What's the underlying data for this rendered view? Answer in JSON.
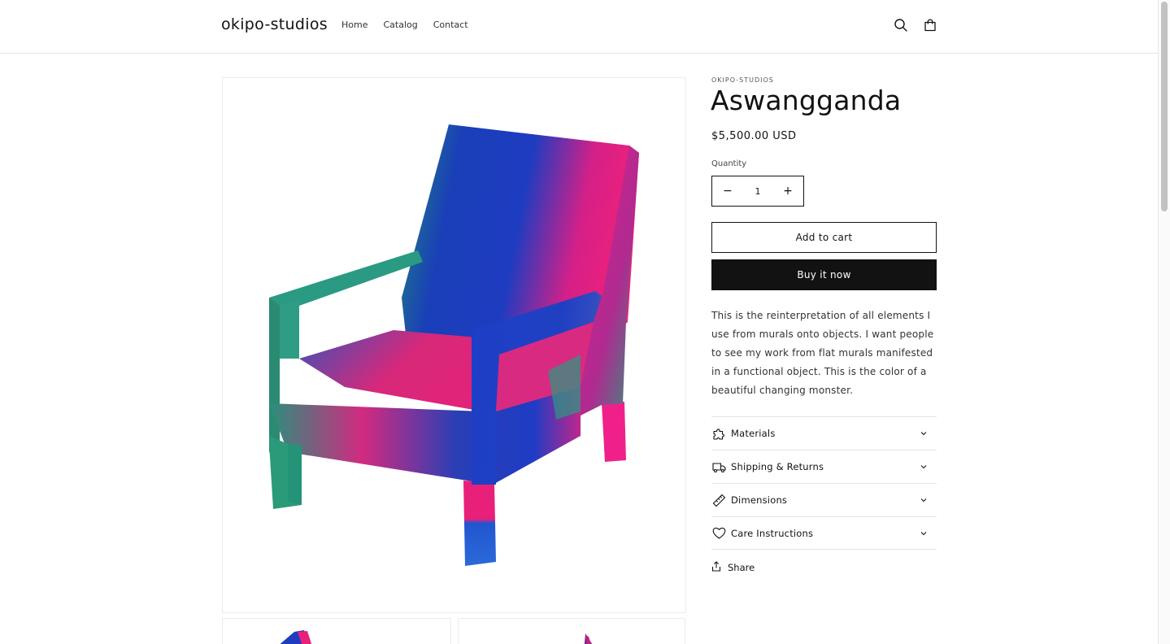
{
  "header": {
    "logo": "okipo-studios",
    "nav": [
      {
        "label": "Home"
      },
      {
        "label": "Catalog"
      },
      {
        "label": "Contact"
      }
    ],
    "icons": [
      "search-icon",
      "cart-icon"
    ]
  },
  "product": {
    "vendor": "OKIPO-STUDIOS",
    "title": "Aswangganda",
    "price": "$5,500.00 USD",
    "quantity_label": "Quantity",
    "quantity_value": "1",
    "decrease_symbol": "−",
    "increase_symbol": "+",
    "add_to_cart": "Add to cart",
    "buy_now": "Buy it now",
    "description": "This is the reinterpretation of all elements I use from murals onto objects. I want people to see my work from flat murals manifested in a functional object. This is the color of a beautiful changing monster.",
    "accordions": [
      {
        "label": "Materials",
        "icon": "puzzle-icon"
      },
      {
        "label": "Shipping & Returns",
        "icon": "truck-icon"
      },
      {
        "label": "Dimensions",
        "icon": "ruler-icon"
      },
      {
        "label": "Care Instructions",
        "icon": "heart-icon"
      }
    ],
    "share_label": "Share"
  },
  "colors": {
    "text": "#121212",
    "button_dark": "#121212",
    "chair_blue": "#1a3fb8",
    "chair_pink": "#e8207a",
    "chair_teal": "#2a9a7e"
  }
}
